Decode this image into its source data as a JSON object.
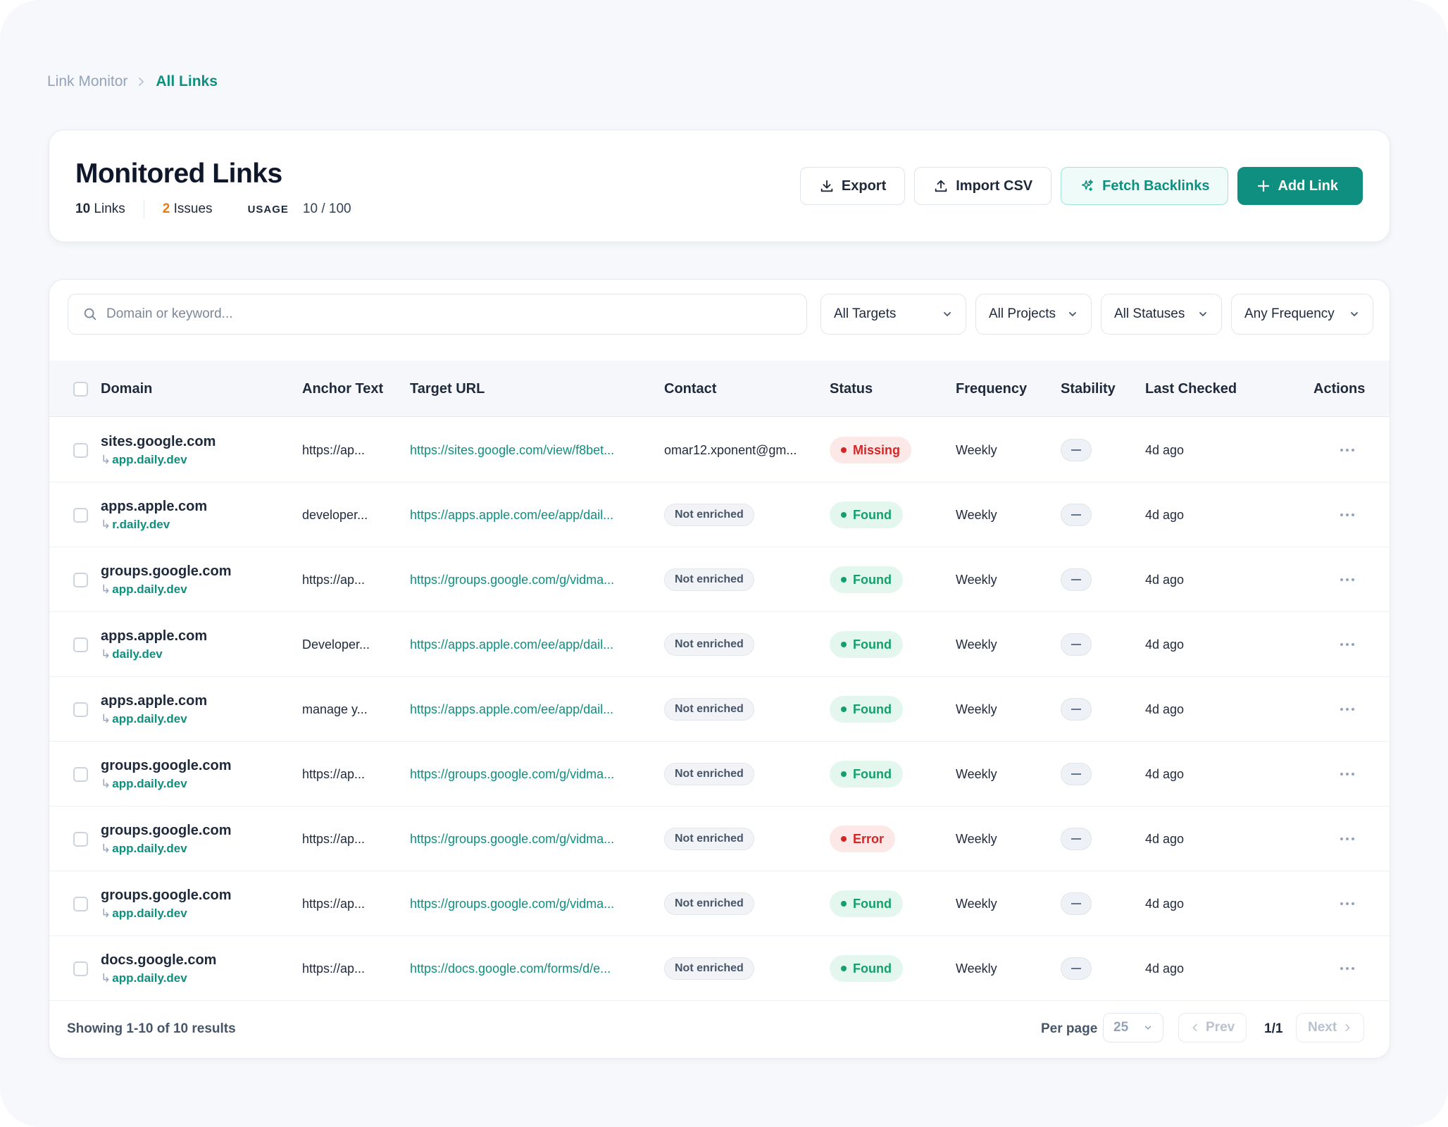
{
  "breadcrumb": {
    "parent": "Link Monitor",
    "current": "All Links"
  },
  "header": {
    "title": "Monitored Links",
    "links_count": "10",
    "links_label": "Links",
    "issues_count": "2",
    "issues_label": "Issues",
    "usage_label": "USAGE",
    "usage_value": "10 / 100"
  },
  "actions": {
    "export": "Export",
    "import_csv": "Import CSV",
    "fetch_backlinks": "Fetch Backlinks",
    "add_link": "Add Link"
  },
  "filters": {
    "search_placeholder": "Domain or keyword...",
    "targets": "All Targets",
    "projects": "All Projects",
    "statuses": "All Statuses",
    "frequency": "Any Frequency"
  },
  "columns": {
    "domain": "Domain",
    "anchor": "Anchor Text",
    "target": "Target URL",
    "contact": "Contact",
    "status": "Status",
    "frequency": "Frequency",
    "stability": "Stability",
    "last_checked": "Last Checked",
    "actions": "Actions"
  },
  "rows": [
    {
      "domain": "sites.google.com",
      "sub": "app.daily.dev",
      "anchor": "https://ap...",
      "target": "https://sites.google.com/view/f8bet...",
      "contact": "omar12.xponent@gm...",
      "contact_enriched": true,
      "status": "Missing",
      "status_kind": "missing",
      "frequency": "Weekly",
      "last_checked": "4d ago"
    },
    {
      "domain": "apps.apple.com",
      "sub": "r.daily.dev",
      "anchor": "developer...",
      "target": "https://apps.apple.com/ee/app/dail...",
      "contact": "Not enriched",
      "contact_enriched": false,
      "status": "Found",
      "status_kind": "found",
      "frequency": "Weekly",
      "last_checked": "4d ago"
    },
    {
      "domain": "groups.google.com",
      "sub": "app.daily.dev",
      "anchor": "https://ap...",
      "target": "https://groups.google.com/g/vidma...",
      "contact": "Not enriched",
      "contact_enriched": false,
      "status": "Found",
      "status_kind": "found",
      "frequency": "Weekly",
      "last_checked": "4d ago"
    },
    {
      "domain": "apps.apple.com",
      "sub": "daily.dev",
      "anchor": "Developer...",
      "target": "https://apps.apple.com/ee/app/dail...",
      "contact": "Not enriched",
      "contact_enriched": false,
      "status": "Found",
      "status_kind": "found",
      "frequency": "Weekly",
      "last_checked": "4d ago"
    },
    {
      "domain": "apps.apple.com",
      "sub": "app.daily.dev",
      "anchor": "manage y...",
      "target": "https://apps.apple.com/ee/app/dail...",
      "contact": "Not enriched",
      "contact_enriched": false,
      "status": "Found",
      "status_kind": "found",
      "frequency": "Weekly",
      "last_checked": "4d ago"
    },
    {
      "domain": "groups.google.com",
      "sub": "app.daily.dev",
      "anchor": "https://ap...",
      "target": "https://groups.google.com/g/vidma...",
      "contact": "Not enriched",
      "contact_enriched": false,
      "status": "Found",
      "status_kind": "found",
      "frequency": "Weekly",
      "last_checked": "4d ago"
    },
    {
      "domain": "groups.google.com",
      "sub": "app.daily.dev",
      "anchor": "https://ap...",
      "target": "https://groups.google.com/g/vidma...",
      "contact": "Not enriched",
      "contact_enriched": false,
      "status": "Error",
      "status_kind": "error",
      "frequency": "Weekly",
      "last_checked": "4d ago"
    },
    {
      "domain": "groups.google.com",
      "sub": "app.daily.dev",
      "anchor": "https://ap...",
      "target": "https://groups.google.com/g/vidma...",
      "contact": "Not enriched",
      "contact_enriched": false,
      "status": "Found",
      "status_kind": "found",
      "frequency": "Weekly",
      "last_checked": "4d ago"
    },
    {
      "domain": "docs.google.com",
      "sub": "app.daily.dev",
      "anchor": "https://ap...",
      "target": "https://docs.google.com/forms/d/e...",
      "contact": "Not enriched",
      "contact_enriched": false,
      "status": "Found",
      "status_kind": "found",
      "frequency": "Weekly",
      "last_checked": "4d ago"
    }
  ],
  "pagination": {
    "summary": "Showing 1-10 of 10 results",
    "per_page_label": "Per page",
    "per_page_value": "25",
    "prev": "Prev",
    "indicator": "1/1",
    "next": "Next"
  },
  "colors": {
    "accent": "#0f8f80",
    "found": "#14a06d",
    "error": "#d32626",
    "issues": "#ea7a12"
  },
  "icons": {
    "export": "download-icon",
    "import": "upload-icon",
    "fetch": "sparkles-icon",
    "add": "plus-icon",
    "search": "search-icon",
    "row_actions": "more-horizontal-icon"
  }
}
